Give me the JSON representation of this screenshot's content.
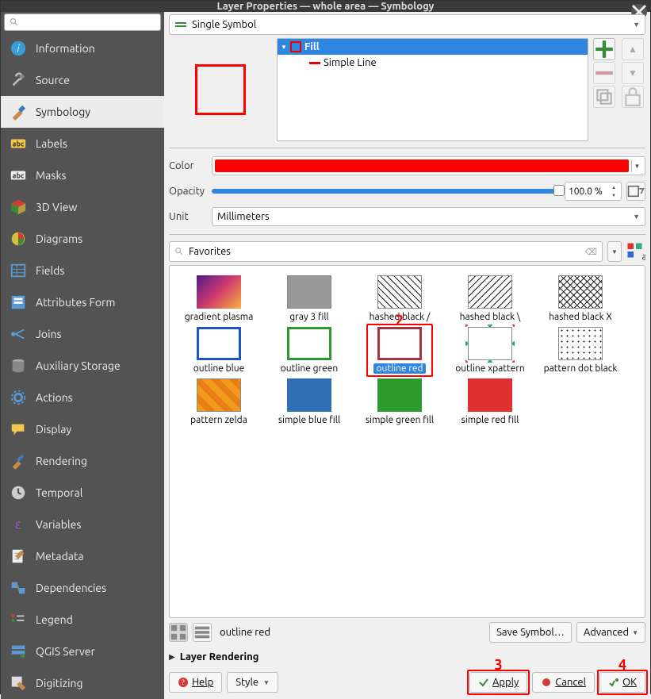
{
  "window": {
    "title": "Layer Properties — whole area — Symbology"
  },
  "sidebar": {
    "search_placeholder": "",
    "items": [
      {
        "label": "Information"
      },
      {
        "label": "Source"
      },
      {
        "label": "Symbology"
      },
      {
        "label": "Labels"
      },
      {
        "label": "Masks"
      },
      {
        "label": "3D View"
      },
      {
        "label": "Diagrams"
      },
      {
        "label": "Fields"
      },
      {
        "label": "Attributes Form"
      },
      {
        "label": "Joins"
      },
      {
        "label": "Auxiliary Storage"
      },
      {
        "label": "Actions"
      },
      {
        "label": "Display"
      },
      {
        "label": "Rendering"
      },
      {
        "label": "Temporal"
      },
      {
        "label": "Variables"
      },
      {
        "label": "Metadata"
      },
      {
        "label": "Dependencies"
      },
      {
        "label": "Legend"
      },
      {
        "label": "QGIS Server"
      },
      {
        "label": "Digitizing"
      }
    ]
  },
  "symbol_type": "Single Symbol",
  "layer_tree": {
    "root": "Fill",
    "child": "Simple Line"
  },
  "props": {
    "color_label": "Color",
    "color_value": "#ff0000",
    "opacity_label": "Opacity",
    "opacity_value": "100.0 %",
    "unit_label": "Unit",
    "unit_value": "Millimeters"
  },
  "gallery": {
    "filter": "Favorites",
    "items": [
      {
        "label": "gradient plasma"
      },
      {
        "label": "gray 3 fill"
      },
      {
        "label": "hashed black /"
      },
      {
        "label": "hashed black \\"
      },
      {
        "label": "hashed black X"
      },
      {
        "label": "outline blue"
      },
      {
        "label": "outline green"
      },
      {
        "label": "outline red"
      },
      {
        "label": "outline xpattern"
      },
      {
        "label": "pattern dot black"
      },
      {
        "label": "pattern zelda"
      },
      {
        "label": "simple blue fill"
      },
      {
        "label": "simple green fill"
      },
      {
        "label": "simple red fill"
      }
    ],
    "selected_index": 7
  },
  "status": {
    "name": "outline red",
    "save": "Save Symbol…",
    "advanced": "Advanced"
  },
  "rendering_label": "Layer Rendering",
  "buttons": {
    "help": "Help",
    "style": "Style",
    "apply": "Apply",
    "cancel": "Cancel",
    "ok": "OK"
  },
  "annotations": {
    "step2": "2",
    "step3": "3",
    "step4": "4"
  }
}
